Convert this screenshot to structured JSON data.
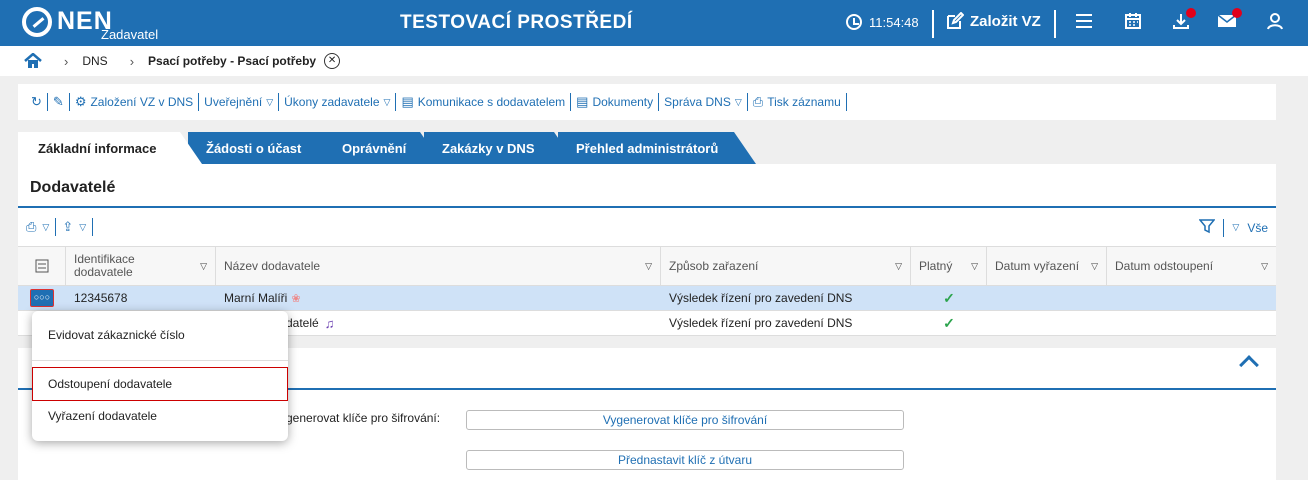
{
  "header": {
    "logo_text": "NEN",
    "logo_sub": "Zadavatel",
    "environment": "TESTOVACÍ PROSTŘEDÍ",
    "time": "11:54:48",
    "create_label": "Založit VZ"
  },
  "breadcrumb": {
    "items": [
      "DNS",
      "Psací potřeby - Psací potřeby"
    ]
  },
  "toolbar": {
    "items": [
      "Založení VZ v DNS",
      "Uveřejnění",
      "Úkony zadavatele",
      "Komunikace s dodavatelem",
      "Dokumenty",
      "Správa DNS",
      "Tisk záznamu"
    ]
  },
  "tabs": [
    "Základní informace",
    "Žádosti o účast",
    "Oprávnění",
    "Zakázky v DNS",
    "Přehled administrátorů"
  ],
  "panel": {
    "title": "Dodavatelé",
    "filter_label": "Vše"
  },
  "table": {
    "columns": [
      "Identifikace dodavatele",
      "Název dodavatele",
      "Způsob zařazení",
      "Platný",
      "Datum vyřazení",
      "Datum odstoupení"
    ],
    "rows": [
      {
        "id": "12345678",
        "name": "Marní Malíři",
        "method": "Výsledek řízení pro zavedení DNS",
        "valid": "✓"
      },
      {
        "id": "",
        "name": "datelé",
        "method": "Výsledek řízení pro zavedení DNS",
        "valid": "✓"
      }
    ]
  },
  "lower": {
    "label": "ygenerovat klíče pro šifrování:",
    "btn_generate": "Vygenerovat klíče pro šifrování",
    "btn_preset": "Přednastavit klíč z útvaru"
  },
  "context_menu": {
    "items": [
      "Evidovat zákaznické číslo",
      "Odstoupení dodavatele",
      "Vyřazení dodavatele"
    ]
  },
  "colors": {
    "brand": "#1f6fb3",
    "selected_row": "#cfe2f7",
    "alert": "#e2001a"
  }
}
